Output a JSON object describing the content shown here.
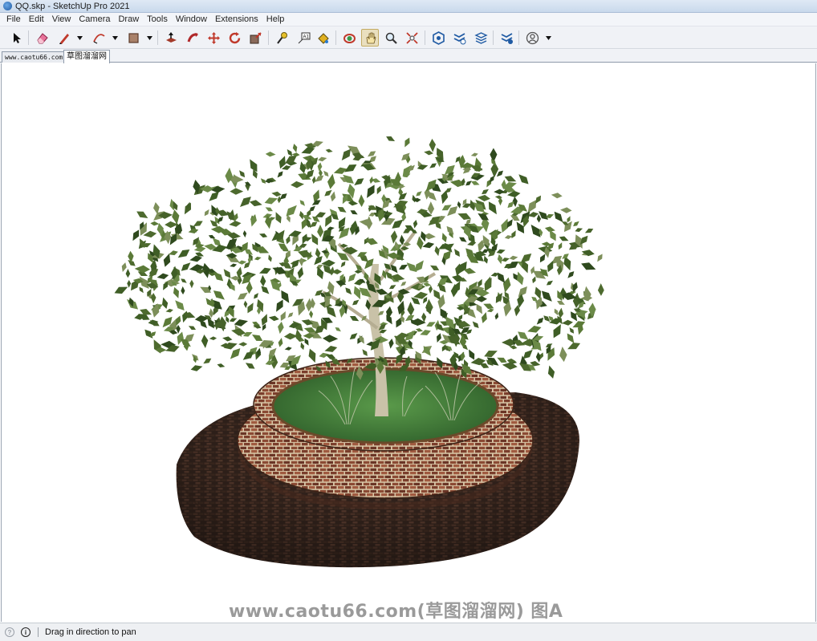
{
  "window": {
    "title": "QQ.skp - SketchUp Pro 2021"
  },
  "menu": [
    "File",
    "Edit",
    "View",
    "Camera",
    "Draw",
    "Tools",
    "Window",
    "Extensions",
    "Help"
  ],
  "toolbar": {
    "tools": [
      "select-icon",
      "eraser-icon",
      "pencil-line-icon",
      "arc-icon",
      "rectangle-icon",
      "push-pull-icon",
      "follow-me-icon",
      "move-icon",
      "rotate-icon",
      "scale-icon",
      "tape-measure-icon",
      "text-label-icon",
      "paint-bucket-icon",
      "orbit-icon",
      "pan-icon",
      "zoom-icon",
      "zoom-extents-icon",
      "warehouse-icon",
      "extension-warehouse-icon",
      "layout-icon",
      "extension-manager-icon",
      "account-icon"
    ],
    "active_tool": "pan-icon"
  },
  "tabs": [
    "www.caotu66.com",
    "草图溜溜网"
  ],
  "selected_tab": 1,
  "watermark": "www.caotu66.com(草图溜溜网) 图A",
  "status": {
    "hint": "Drag in direction to pan"
  },
  "colors": {
    "accent": "#1f5aa3",
    "leaf": "#4d6a2e",
    "brick": "#7a3a28",
    "grass": "#3f7a3a"
  }
}
